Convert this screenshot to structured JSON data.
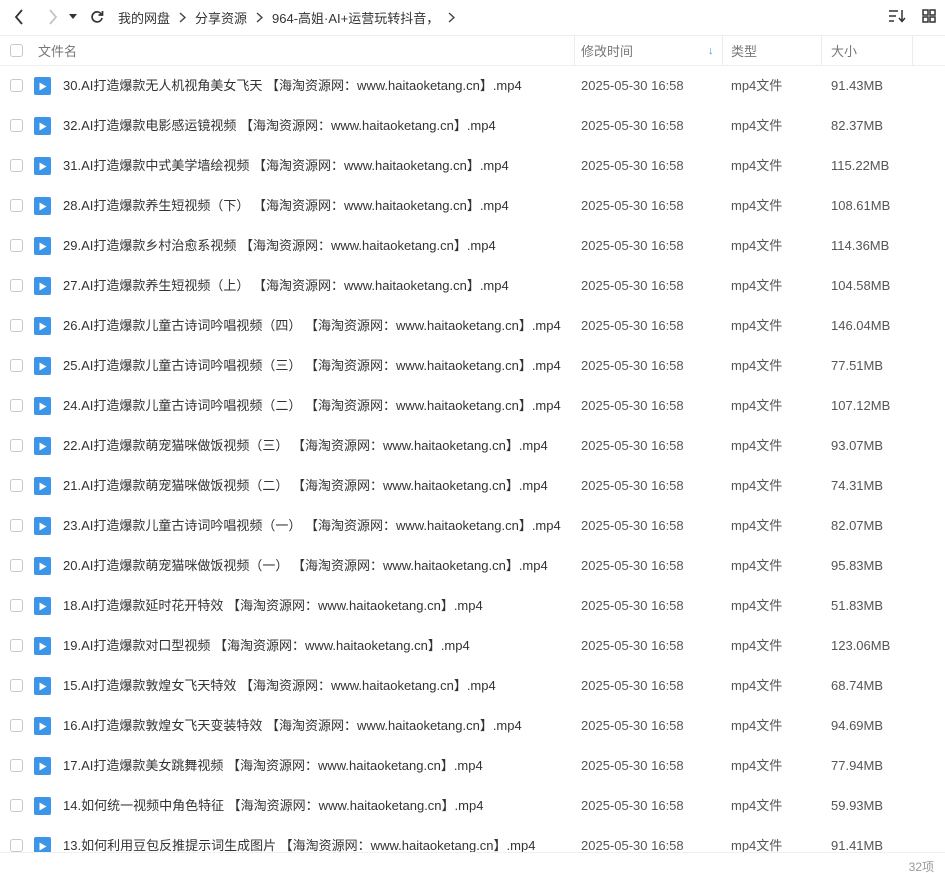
{
  "toolbar": {
    "back_icon": "chevron-left-icon",
    "forward_icon": "chevron-right-icon",
    "history_icon": "caret-down-icon",
    "refresh_icon": "refresh-icon",
    "breadcrumb": [
      "我的网盘",
      "分享资源",
      "964-高姐·AI+运营玩转抖音，"
    ],
    "sort_icon": "sort-list-icon",
    "view_icon": "grid-view-icon"
  },
  "columns": {
    "name": "文件名",
    "modified": "修改时间",
    "type": "类型",
    "size": "大小",
    "sort_indicator": "↓"
  },
  "colors": {
    "accent": "#3d95ea",
    "text": "#333333",
    "muted": "#777777"
  },
  "files": [
    {
      "name": "30.AI打造爆款无人机视角美女飞天 【海淘资源网：www.haitaoketang.cn】.mp4",
      "modified": "2025-05-30 16:58",
      "type": "mp4文件",
      "size": "91.43MB"
    },
    {
      "name": "32.AI打造爆款电影感运镜视频 【海淘资源网：www.haitaoketang.cn】.mp4",
      "modified": "2025-05-30 16:58",
      "type": "mp4文件",
      "size": "82.37MB"
    },
    {
      "name": "31.AI打造爆款中式美学墙绘视频 【海淘资源网：www.haitaoketang.cn】.mp4",
      "modified": "2025-05-30 16:58",
      "type": "mp4文件",
      "size": "115.22MB"
    },
    {
      "name": "28.AI打造爆款养生短视频（下） 【海淘资源网：www.haitaoketang.cn】.mp4",
      "modified": "2025-05-30 16:58",
      "type": "mp4文件",
      "size": "108.61MB"
    },
    {
      "name": "29.AI打造爆款乡村治愈系视频 【海淘资源网：www.haitaoketang.cn】.mp4",
      "modified": "2025-05-30 16:58",
      "type": "mp4文件",
      "size": "114.36MB"
    },
    {
      "name": "27.AI打造爆款养生短视频（上） 【海淘资源网：www.haitaoketang.cn】.mp4",
      "modified": "2025-05-30 16:58",
      "type": "mp4文件",
      "size": "104.58MB"
    },
    {
      "name": "26.AI打造爆款儿童古诗词吟唱视频（四） 【海淘资源网：www.haitaoketang.cn】.mp4",
      "modified": "2025-05-30 16:58",
      "type": "mp4文件",
      "size": "146.04MB"
    },
    {
      "name": "25.AI打造爆款儿童古诗词吟唱视频（三） 【海淘资源网：www.haitaoketang.cn】.mp4",
      "modified": "2025-05-30 16:58",
      "type": "mp4文件",
      "size": "77.51MB"
    },
    {
      "name": "24.AI打造爆款儿童古诗词吟唱视频（二） 【海淘资源网：www.haitaoketang.cn】.mp4",
      "modified": "2025-05-30 16:58",
      "type": "mp4文件",
      "size": "107.12MB"
    },
    {
      "name": "22.AI打造爆款萌宠猫咪做饭视频（三） 【海淘资源网：www.haitaoketang.cn】.mp4",
      "modified": "2025-05-30 16:58",
      "type": "mp4文件",
      "size": "93.07MB"
    },
    {
      "name": "21.AI打造爆款萌宠猫咪做饭视频（二） 【海淘资源网：www.haitaoketang.cn】.mp4",
      "modified": "2025-05-30 16:58",
      "type": "mp4文件",
      "size": "74.31MB"
    },
    {
      "name": "23.AI打造爆款儿童古诗词吟唱视频（一） 【海淘资源网：www.haitaoketang.cn】.mp4",
      "modified": "2025-05-30 16:58",
      "type": "mp4文件",
      "size": "82.07MB"
    },
    {
      "name": "20.AI打造爆款萌宠猫咪做饭视频（一） 【海淘资源网：www.haitaoketang.cn】.mp4",
      "modified": "2025-05-30 16:58",
      "type": "mp4文件",
      "size": "95.83MB"
    },
    {
      "name": "18.AI打造爆款延时花开特效 【海淘资源网：www.haitaoketang.cn】.mp4",
      "modified": "2025-05-30 16:58",
      "type": "mp4文件",
      "size": "51.83MB"
    },
    {
      "name": "19.AI打造爆款对口型视频 【海淘资源网：www.haitaoketang.cn】.mp4",
      "modified": "2025-05-30 16:58",
      "type": "mp4文件",
      "size": "123.06MB"
    },
    {
      "name": "15.AI打造爆款敦煌女飞天特效 【海淘资源网：www.haitaoketang.cn】.mp4",
      "modified": "2025-05-30 16:58",
      "type": "mp4文件",
      "size": "68.74MB"
    },
    {
      "name": "16.AI打造爆款敦煌女飞天变装特效 【海淘资源网：www.haitaoketang.cn】.mp4",
      "modified": "2025-05-30 16:58",
      "type": "mp4文件",
      "size": "94.69MB"
    },
    {
      "name": "17.AI打造爆款美女跳舞视频 【海淘资源网：www.haitaoketang.cn】.mp4",
      "modified": "2025-05-30 16:58",
      "type": "mp4文件",
      "size": "77.94MB"
    },
    {
      "name": "14.如何统一视频中角色特征 【海淘资源网：www.haitaoketang.cn】.mp4",
      "modified": "2025-05-30 16:58",
      "type": "mp4文件",
      "size": "59.93MB"
    },
    {
      "name": "13.如何利用豆包反推提示词生成图片 【海淘资源网：www.haitaoketang.cn】.mp4",
      "modified": "2025-05-30 16:58",
      "type": "mp4文件",
      "size": "91.41MB"
    }
  ],
  "footer": {
    "count": "32项"
  }
}
